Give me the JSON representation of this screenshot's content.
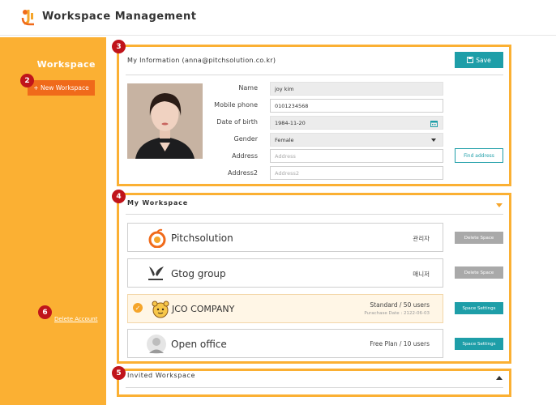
{
  "header": {
    "title": "Workspace Management",
    "logo_icon": "workspace-logo-icon"
  },
  "sidebar": {
    "title": "Workspace",
    "new_workspace_label": "+ New Workspace",
    "delete_account_label": "Delete Account"
  },
  "badges": {
    "b2": "2",
    "b3": "3",
    "b4": "4",
    "b5": "5",
    "b6": "6"
  },
  "my_info": {
    "title": "My Information (anna@pitchsolution.co.kr)",
    "save_label": "Save",
    "fields": {
      "name": {
        "label": "Name",
        "value": "joy kim"
      },
      "mobile": {
        "label": "Mobile phone",
        "value": "0101234568"
      },
      "dob": {
        "label": "Date of birth",
        "value": "1984-11-20"
      },
      "gender": {
        "label": "Gender",
        "value": "Female"
      },
      "address": {
        "label": "Address",
        "placeholder": "Address"
      },
      "address2": {
        "label": "Address2",
        "placeholder": "Address2"
      }
    },
    "find_address_label": "Find address"
  },
  "my_workspace": {
    "title": "My Workspace",
    "items": [
      {
        "name": "Pitchsolution",
        "role": "관리자",
        "action": "Delete Space"
      },
      {
        "name": "Gtog group",
        "role": "매니저",
        "action": "Delete Space"
      },
      {
        "name": "JCO COMPANY",
        "plan": "Standard / 50 users",
        "date": "Purachase Date : 2122-06-03",
        "action": "Space Settings"
      },
      {
        "name": "Open office",
        "plan": "Free Plan / 10 users",
        "action": "Space Settings"
      }
    ]
  },
  "invited_workspace": {
    "title": "Invited Workspace"
  },
  "colors": {
    "accent": "#fbb033",
    "brand_orange": "#f06a1a",
    "teal": "#1e9ea8",
    "badge_red": "#c0141b"
  }
}
